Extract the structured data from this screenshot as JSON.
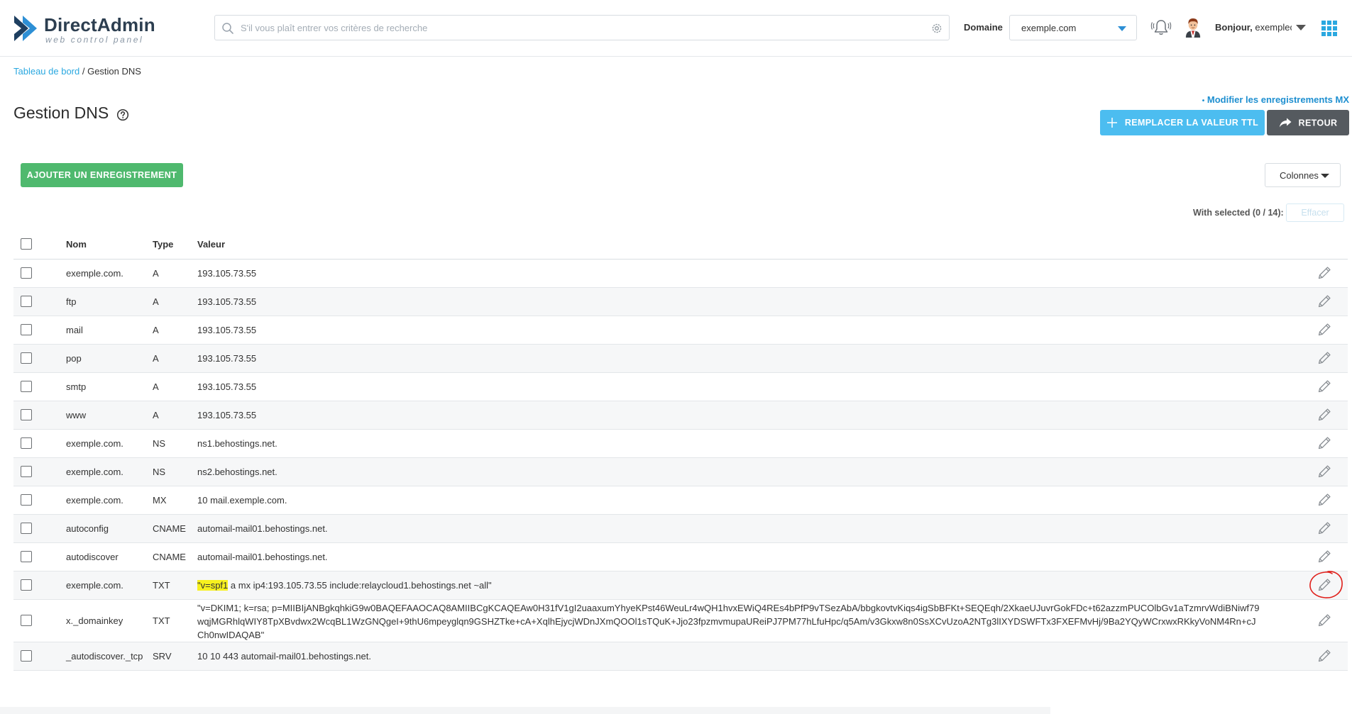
{
  "header": {
    "logo": {
      "name": "DirectAdmin",
      "subtitle": "web control panel"
    },
    "search": {
      "placeholder": "S'il vous plaît entrer vos critères de recherche"
    },
    "domain": {
      "label": "Domaine",
      "value": "exemple.com"
    },
    "user": {
      "greeting_bold": "Bonjour,",
      "username": "exemplec"
    },
    "icons": [
      "search-icon",
      "gear-icon",
      "bell-icon",
      "avatar",
      "apps-grid-icon"
    ]
  },
  "breadcrumb": {
    "home": "Tableau de bord",
    "separator": " / ",
    "current": "Gestion DNS"
  },
  "page": {
    "title": "Gestion DNS"
  },
  "actions": {
    "mx_link": "Modifier les enregistrements MX",
    "replace_ttl": "Remplacer la valeur TTL",
    "back": "Retour",
    "add_record": "Ajouter un enregistrement",
    "columns": "Colonnes",
    "with_selected": "With selected (0 / 14):",
    "delete": "Effacer"
  },
  "table": {
    "headers": {
      "name": "Nom",
      "type": "Type",
      "value": "Valeur"
    },
    "rows": [
      {
        "name": "exemple.com.",
        "type": "A",
        "value": "193.105.73.55"
      },
      {
        "name": "ftp",
        "type": "A",
        "value": "193.105.73.55"
      },
      {
        "name": "mail",
        "type": "A",
        "value": "193.105.73.55"
      },
      {
        "name": "pop",
        "type": "A",
        "value": "193.105.73.55"
      },
      {
        "name": "smtp",
        "type": "A",
        "value": "193.105.73.55"
      },
      {
        "name": "www",
        "type": "A",
        "value": "193.105.73.55"
      },
      {
        "name": "exemple.com.",
        "type": "NS",
        "value": "ns1.behostings.net."
      },
      {
        "name": "exemple.com.",
        "type": "NS",
        "value": "ns2.behostings.net."
      },
      {
        "name": "exemple.com.",
        "type": "MX",
        "value": "10 mail.exemple.com."
      },
      {
        "name": "autoconfig",
        "type": "CNAME",
        "value": "automail-mail01.behostings.net."
      },
      {
        "name": "autodiscover",
        "type": "CNAME",
        "value": "automail-mail01.behostings.net."
      },
      {
        "name": "exemple.com.",
        "type": "TXT",
        "value_highlight": "\"v=spf1",
        "value_rest": " a mx ip4:193.105.73.55 include:relaycloud1.behostings.net ~all\""
      },
      {
        "name": "x._domainkey",
        "type": "TXT",
        "value": "\"v=DKIM1; k=rsa; p=MIIBIjANBgkqhkiG9w0BAQEFAAOCAQ8AMIIBCgKCAQEAw0H31fV1gI2uaaxumYhyeKPst46WeuLr4wQH1hvxEWiQ4REs4bPfP9vTSezAbA/bbgkovtvKiqs4igSbBFKt+SEQEqh/2XkaeUJuvrGokFDc+t62azzmPUCOlbGv1aTzmrvWdiBNiwf79wqjMGRhlqWIY8TpXBvdwx2WcqBL1WzGNQgeI+9thU6mpeyglqn9GSHZTke+cA+XqlhEjycjWDnJXmQOOl1sTQuK+Jjo23fpzmvmupaUReiPJ7PM77hLfuHpc/q5Am/v3Gkxw8n0SsXCvUzoA2NTg3lIXYDSWFTx3FXEFMvHj/9Ba2YQyWCrxwxRKkyVoNM4Rn+cJCh0nwIDAQAB\""
      },
      {
        "name": "_autodiscover._tcp",
        "type": "SRV",
        "value": "10 10 443 automail-mail01.behostings.net."
      }
    ]
  },
  "colors": {
    "link": "#2aa8e0",
    "ttl_button": "#4cbdf0",
    "back_button": "#555a5f",
    "add_button": "#4fb96e",
    "highlight": "#f7f11e",
    "annotation": "#e0201b"
  }
}
